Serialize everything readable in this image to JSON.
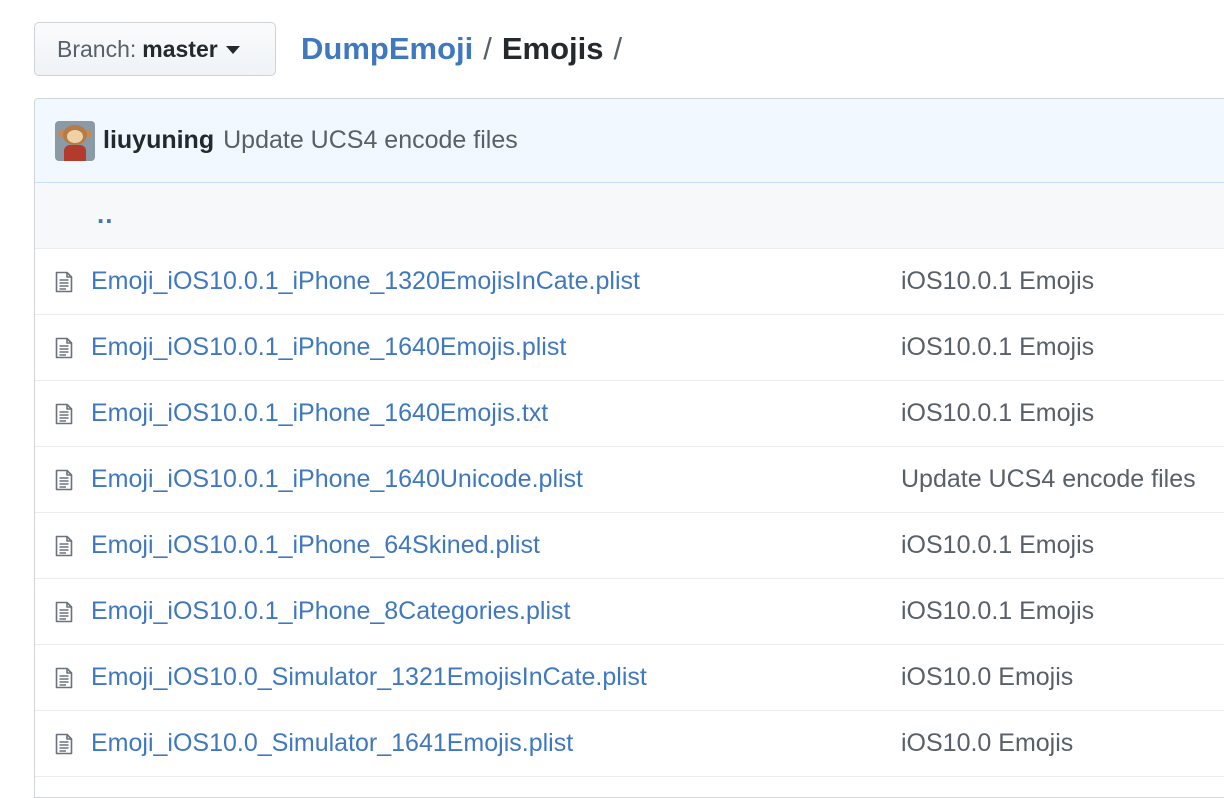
{
  "branch": {
    "prefix": "Branch:",
    "name": "master"
  },
  "breadcrumb": {
    "repo": "DumpEmoji",
    "separator": "/",
    "directory": "Emojis",
    "trailing": "/"
  },
  "commit": {
    "author": "liuyuning",
    "message": "Update UCS4 encode files"
  },
  "parent_dir": {
    "label": ".."
  },
  "files": [
    {
      "name": "Emoji_iOS10.0.1_iPhone_1320EmojisInCate.plist",
      "message": "iOS10.0.1 Emojis",
      "icon": "file-text-icon"
    },
    {
      "name": "Emoji_iOS10.0.1_iPhone_1640Emojis.plist",
      "message": "iOS10.0.1 Emojis",
      "icon": "file-text-icon"
    },
    {
      "name": "Emoji_iOS10.0.1_iPhone_1640Emojis.txt",
      "message": "iOS10.0.1 Emojis",
      "icon": "file-text-icon"
    },
    {
      "name": "Emoji_iOS10.0.1_iPhone_1640Unicode.plist",
      "message": "Update UCS4 encode files",
      "icon": "file-text-icon"
    },
    {
      "name": "Emoji_iOS10.0.1_iPhone_64Skined.plist",
      "message": "iOS10.0.1 Emojis",
      "icon": "file-text-icon"
    },
    {
      "name": "Emoji_iOS10.0.1_iPhone_8Categories.plist",
      "message": "iOS10.0.1 Emojis",
      "icon": "file-text-icon"
    },
    {
      "name": "Emoji_iOS10.0_Simulator_1321EmojisInCate.plist",
      "message": "iOS10.0 Emojis",
      "icon": "file-text-icon"
    },
    {
      "name": "Emoji_iOS10.0_Simulator_1641Emojis.plist",
      "message": "iOS10.0 Emojis",
      "icon": "file-text-icon"
    }
  ],
  "colors": {
    "link": "#4078c0",
    "muted": "#586069",
    "commit_bar_bg": "#f1f8ff",
    "border": "#eaecef"
  }
}
